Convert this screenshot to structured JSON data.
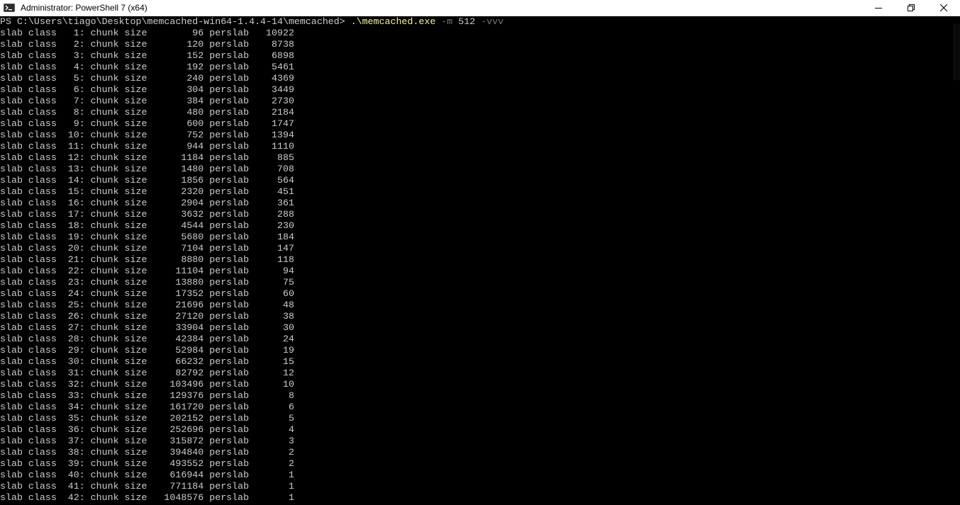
{
  "window": {
    "title": "Administrator: PowerShell 7 (x64)"
  },
  "prompt": {
    "path": "PS C:\\Users\\tiago\\Desktop\\memcached-win64-1.4.4-14\\memcached> ",
    "exe": ".\\memcached.exe",
    "flag_m": " -m ",
    "mem": "512",
    "flag_v": " -vvv"
  },
  "output_lines": [
    "slab class   1: chunk size        96 perslab   10922",
    "slab class   2: chunk size       120 perslab    8738",
    "slab class   3: chunk size       152 perslab    6898",
    "slab class   4: chunk size       192 perslab    5461",
    "slab class   5: chunk size       240 perslab    4369",
    "slab class   6: chunk size       304 perslab    3449",
    "slab class   7: chunk size       384 perslab    2730",
    "slab class   8: chunk size       480 perslab    2184",
    "slab class   9: chunk size       600 perslab    1747",
    "slab class  10: chunk size       752 perslab    1394",
    "slab class  11: chunk size       944 perslab    1110",
    "slab class  12: chunk size      1184 perslab     885",
    "slab class  13: chunk size      1480 perslab     708",
    "slab class  14: chunk size      1856 perslab     564",
    "slab class  15: chunk size      2320 perslab     451",
    "slab class  16: chunk size      2904 perslab     361",
    "slab class  17: chunk size      3632 perslab     288",
    "slab class  18: chunk size      4544 perslab     230",
    "slab class  19: chunk size      5680 perslab     184",
    "slab class  20: chunk size      7104 perslab     147",
    "slab class  21: chunk size      8880 perslab     118",
    "slab class  22: chunk size     11104 perslab      94",
    "slab class  23: chunk size     13880 perslab      75",
    "slab class  24: chunk size     17352 perslab      60",
    "slab class  25: chunk size     21696 perslab      48",
    "slab class  26: chunk size     27120 perslab      38",
    "slab class  27: chunk size     33904 perslab      30",
    "slab class  28: chunk size     42384 perslab      24",
    "slab class  29: chunk size     52984 perslab      19",
    "slab class  30: chunk size     66232 perslab      15",
    "slab class  31: chunk size     82792 perslab      12",
    "slab class  32: chunk size    103496 perslab      10",
    "slab class  33: chunk size    129376 perslab       8",
    "slab class  34: chunk size    161720 perslab       6",
    "slab class  35: chunk size    202152 perslab       5",
    "slab class  36: chunk size    252696 perslab       4",
    "slab class  37: chunk size    315872 perslab       3",
    "slab class  38: chunk size    394840 perslab       2",
    "slab class  39: chunk size    493552 perslab       2",
    "slab class  40: chunk size    616944 perslab       1",
    "slab class  41: chunk size    771184 perslab       1",
    "slab class  42: chunk size   1048576 perslab       1"
  ],
  "colors": {
    "background": "#000000",
    "text": "#cccccc",
    "command": "#f9f1a5",
    "flag": "#767676"
  },
  "icons": {
    "app": "powershell-icon",
    "minimize": "minimize-icon",
    "maximize": "restore-icon",
    "close": "close-icon"
  }
}
